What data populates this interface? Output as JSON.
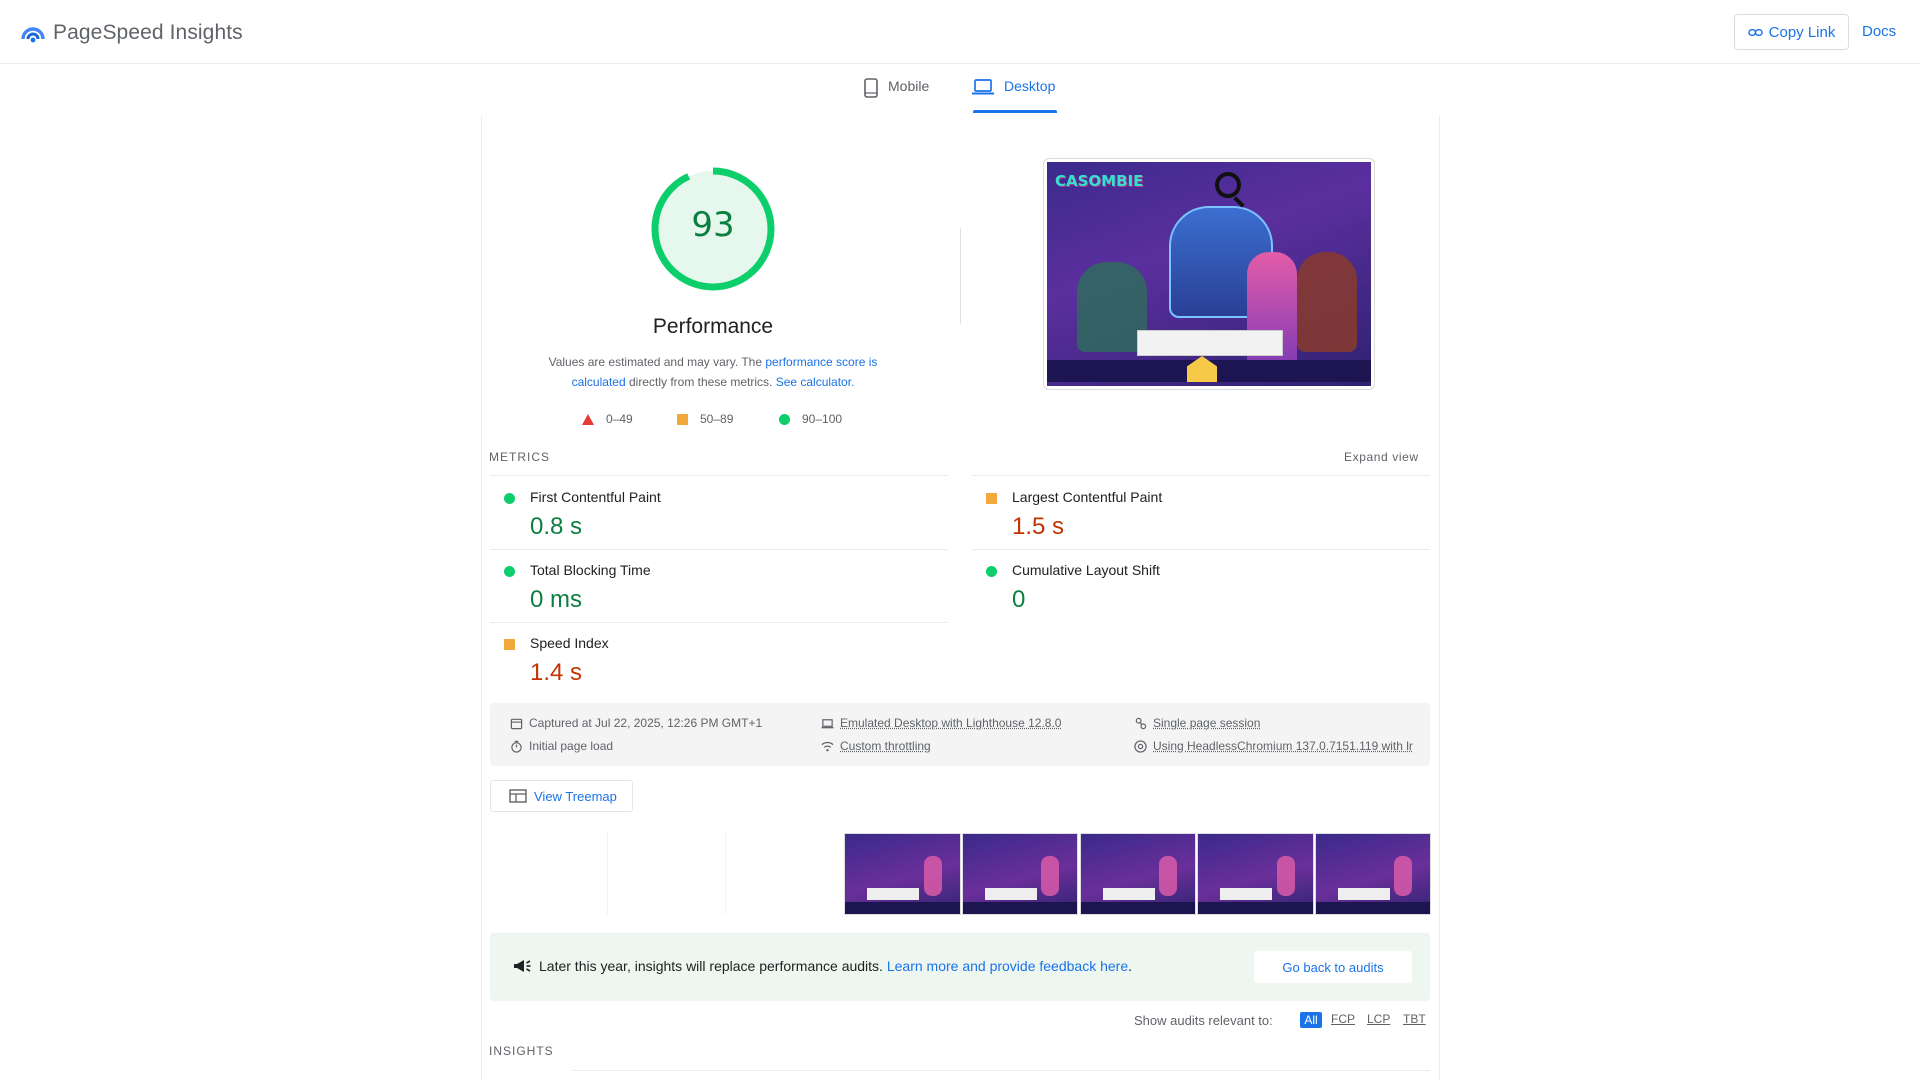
{
  "header": {
    "app_title": "PageSpeed Insights",
    "copy_link_label": "Copy Link",
    "docs_label": "Docs"
  },
  "tabs": [
    {
      "label": "Mobile",
      "icon": "phone-icon",
      "active": false
    },
    {
      "label": "Desktop",
      "icon": "laptop-icon",
      "active": true
    }
  ],
  "score": {
    "value": "93",
    "category": "Performance",
    "desc_part1": "Values are estimated and may vary. The ",
    "desc_link1": "performance score is calculated",
    "desc_part2": " directly from these metrics. ",
    "desc_link2": "See calculator.",
    "color": "#0cce6b",
    "fraction": 0.93
  },
  "legend": [
    {
      "label": "0–49",
      "color": "#e53935"
    },
    {
      "label": "50–89",
      "color": "#f2a93b"
    },
    {
      "label": "90–100",
      "color": "#0cce6b"
    }
  ],
  "metrics": {
    "section_label": "METRICS",
    "expand_label": "Expand view",
    "items": [
      {
        "name": "First Contentful Paint",
        "value": "0.8 s",
        "rating": "good"
      },
      {
        "name": "Largest Contentful Paint",
        "value": "1.5 s",
        "rating": "average"
      },
      {
        "name": "Total Blocking Time",
        "value": "0 ms",
        "rating": "good"
      },
      {
        "name": "Cumulative Layout Shift",
        "value": "0",
        "rating": "good"
      },
      {
        "name": "Speed Index",
        "value": "1.4 s",
        "rating": "average"
      }
    ]
  },
  "runtime": {
    "captured": "Captured at Jul 22, 2025, 12:26 PM GMT+1",
    "initial_load": "Initial page load",
    "emulated": "Emulated Desktop with Lighthouse 12.8.0",
    "throttling": "Custom throttling",
    "session": "Single page session",
    "browser": "Using HeadlessChromium 137.0.7151.119 with lr"
  },
  "treemap_label": "View Treemap",
  "thumbnail": {
    "logo_text": "CASOMBIE"
  },
  "banner": {
    "text": "Later this year, insights will replace performance audits. ",
    "link": "Learn more and provide feedback here",
    "suffix": ".",
    "button": "Go back to audits"
  },
  "filter": {
    "label": "Show audits relevant to:",
    "chips": [
      "All",
      "FCP",
      "LCP",
      "TBT"
    ]
  },
  "insights_label": "INSIGHTS"
}
